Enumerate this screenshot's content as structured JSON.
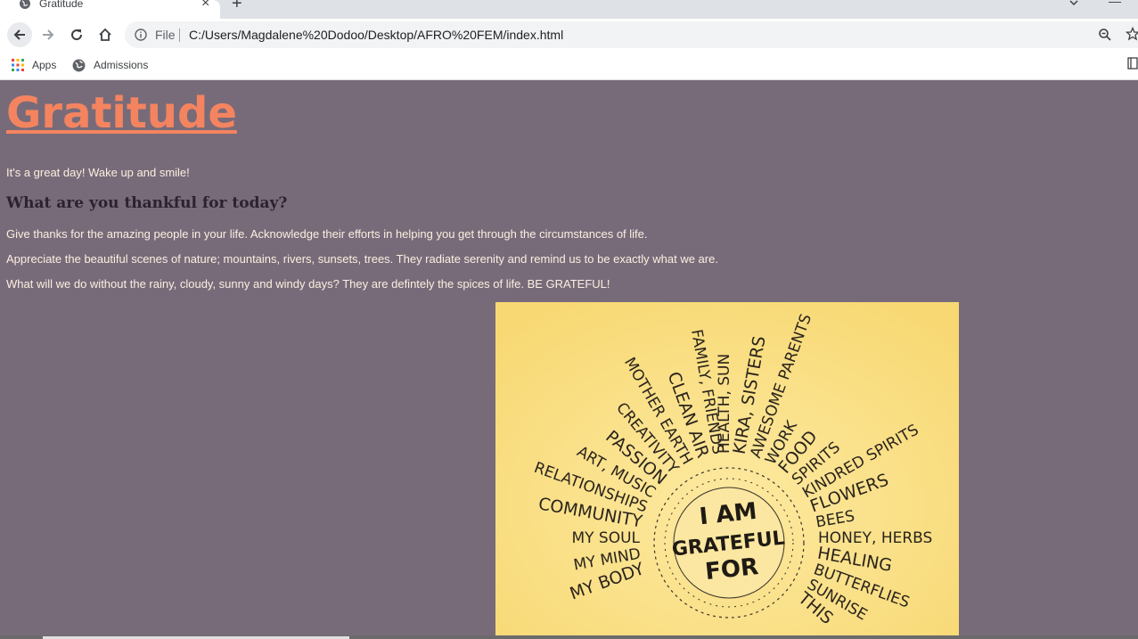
{
  "browser": {
    "tab_title": "Gratitude",
    "new_tab_symbol": "+",
    "close_symbol": "×",
    "minimize_symbol": "—",
    "file_label": "File",
    "url": "C:/Users/Magdalene%20Dodoo/Desktop/AFRO%20FEM/index.html",
    "bookmarks": [
      {
        "label": "Apps",
        "icon": "apps-grid-icon"
      },
      {
        "label": "Admissions",
        "icon": "globe-icon"
      }
    ]
  },
  "page": {
    "title": "Gratitude",
    "tagline": "It's a great day! Wake up and smile!",
    "subheading": "What are you thankful for today?",
    "paragraphs": [
      "Give thanks for the amazing people in your life. Acknowledge their efforts in helping you get through the circumstances of life.",
      "Appreciate the beautiful scenes of nature; mountains, rivers, sunsets, trees. They radiate serenity and remind us to be exactly what we are.",
      "What will we do without the rainy, cloudy, sunny and windy days? They are defintely the spices of life. BE GRATEFUL!"
    ],
    "poster": {
      "center_text": [
        "I AM",
        "GRATEFUL",
        "FOR"
      ],
      "words": [
        "MY BODY",
        "MY MIND",
        "MY SOUL",
        "COMMUNITY",
        "RELATIONSHIPS",
        "ART, MUSIC",
        "PASSION",
        "CREATIVITY",
        "MOTHER EARTH",
        "CLEAN AIR",
        "FAMILY, FRIENDS",
        "HEALTH, SUN",
        "KIRA, SISTERS",
        "AWESOME PARENTS",
        "WORK",
        "FOOD",
        "SPIRITS",
        "KINDRED SPIRITS",
        "FLOWERS",
        "BEES",
        "HONEY, HERBS",
        "HEALING",
        "BUTTERFLIES",
        "SUNRISE",
        "THIS"
      ]
    }
  },
  "colors": {
    "page_bg": "#786b79",
    "heading": "#f4845f",
    "body_text": "#fcefe1",
    "subheading": "#2b2230",
    "poster_bg": "#fce38a"
  }
}
